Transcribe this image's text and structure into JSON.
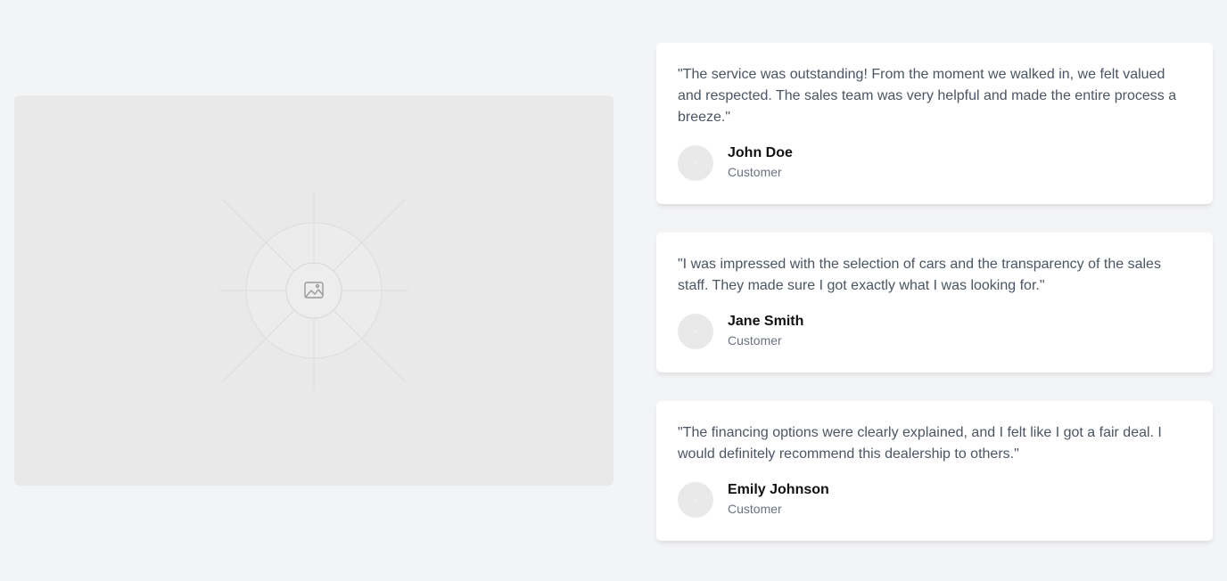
{
  "image": {
    "icon": "image-icon"
  },
  "testimonials": [
    {
      "quote": "\"The service was outstanding! From the moment we walked in, we felt valued and respected. The sales team was very helpful and made the entire process a breeze.\"",
      "name": "John Doe",
      "role": "Customer"
    },
    {
      "quote": "\"I was impressed with the selection of cars and the transparency of the sales staff. They made sure I got exactly what I was looking for.\"",
      "name": "Jane Smith",
      "role": "Customer"
    },
    {
      "quote": "\"The financing options were clearly explained, and I felt like I got a fair deal. I would definitely recommend this dealership to others.\"",
      "name": "Emily Johnson",
      "role": "Customer"
    }
  ]
}
